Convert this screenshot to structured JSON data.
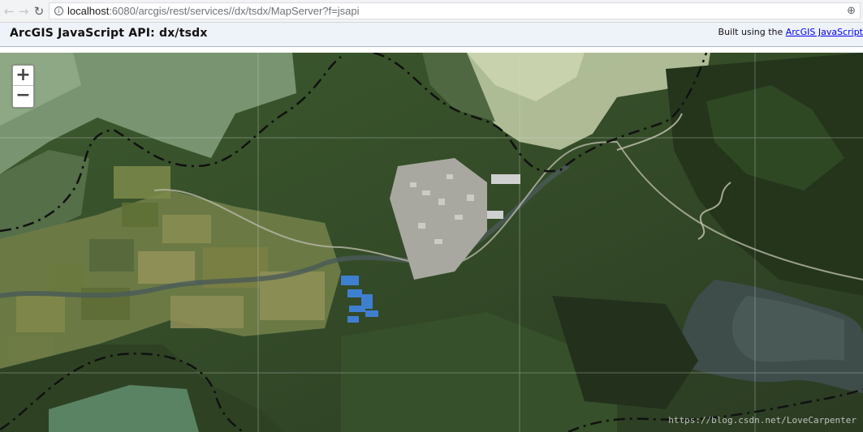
{
  "browser": {
    "back_icon": "back-arrow-icon",
    "forward_icon": "forward-arrow-icon",
    "reload_icon": "reload-icon",
    "url_host": "localhost",
    "url_rest": ":6080/arcgis/rest/services//dx/tsdx/MapServer?f=jsapi",
    "zoom_icon": "magnifier-icon"
  },
  "header": {
    "title": "ArcGIS JavaScript API: dx/tsdx",
    "built_prefix": "Built using the ",
    "built_link": "ArcGIS JavaScript"
  },
  "map": {
    "zoom_in_label": "+",
    "zoom_out_label": "−",
    "layer": "satellite imagery"
  },
  "watermark": "https://blog.csdn.net/LoveCarpenter",
  "colors": {
    "header_bg": "#eef2f9",
    "link": "#0000ee",
    "boundary": "#111111"
  }
}
